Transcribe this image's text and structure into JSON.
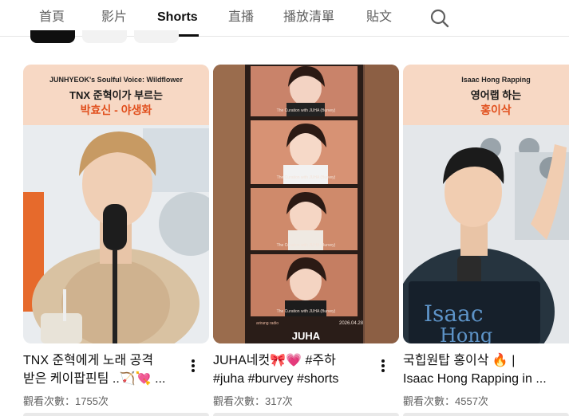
{
  "tabs": [
    {
      "label": "首頁",
      "active": false
    },
    {
      "label": "影片",
      "active": false
    },
    {
      "label": "Shorts",
      "active": true
    },
    {
      "label": "直播",
      "active": false
    },
    {
      "label": "播放清單",
      "active": false
    },
    {
      "label": "貼文",
      "active": false
    }
  ],
  "search_icon": "search-icon",
  "colors": {
    "accent_orange": "#e1501e",
    "header_peach": "#f7d8c4",
    "film_frame": "#2a1d18",
    "text_primary": "#0f0f0f",
    "text_secondary": "#606060"
  },
  "shorts": [
    {
      "overlay_small": "JUNHYEOK's Soulful Voice: Wildflower",
      "overlay_line1": "TNX 준혁이가 부르는",
      "overlay_line2": "박효신 - 야생화",
      "title_line1": "TNX 준혁에게 노래 공격",
      "title_line2": "받은 케이팝핀팀 ..🏹💘 ...",
      "views": "觀看次數：1755次"
    },
    {
      "caption_1": "The Curation with JUHA (Burvey)",
      "caption_2": "The Curation with JUHA (Burvey)",
      "caption_3": "The Curation with JUHA (Burvey)",
      "caption_4": "The Curation with JUHA (Burvey)",
      "date": "2026.04.28",
      "logo_small": "arirang radio",
      "logo_big": "JUHA",
      "title_line1": "JUHA네컷🎀💗 #주하",
      "title_line2": "#juha #burvey #shorts",
      "views": "觀看次數：317次"
    },
    {
      "overlay_small": "Isaac Hong Rapping",
      "overlay_line1": "영어랩 하는",
      "overlay_line2": "홍이삭",
      "board_line1": "Isaac",
      "board_line2": "Hong",
      "title_line1": "국힙원탑 홍이삭 🔥 |",
      "title_line2": "Isaac Hong Rapping in ...",
      "views": "觀看次數：4557次"
    }
  ]
}
